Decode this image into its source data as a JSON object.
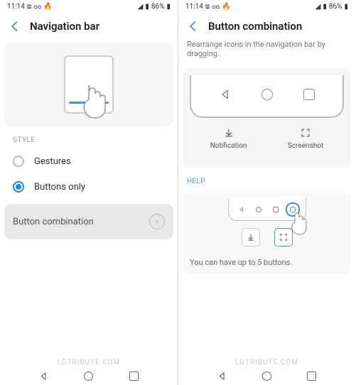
{
  "status": {
    "time": "11:14",
    "battery": "86%"
  },
  "left": {
    "title": "Navigation bar",
    "section": "STYLE",
    "opt1": "Gestures",
    "opt2": "Buttons only",
    "combo": "Button combination"
  },
  "right": {
    "title": "Button combination",
    "sub": "Rearrange icons in the navigation bar by dragging.",
    "extra1": "Notification",
    "extra2": "Screenshot",
    "help": "HELP",
    "helptext": "You can have up to 5 buttons."
  },
  "watermark": "LGTRIBUTE.COM"
}
